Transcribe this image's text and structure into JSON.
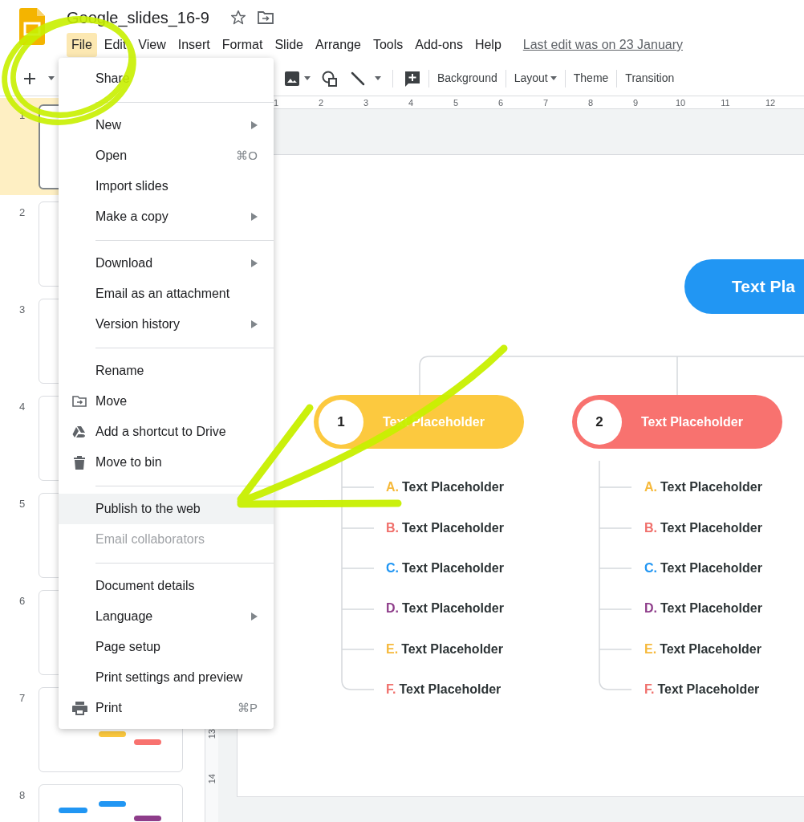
{
  "document": {
    "title": "Google_slides_16-9",
    "last_edit": "Last edit was on 23 January"
  },
  "menu_bar": [
    {
      "label": "File",
      "selected": true
    },
    {
      "label": "Edit",
      "selected": false
    },
    {
      "label": "View",
      "selected": false
    },
    {
      "label": "Insert",
      "selected": false
    },
    {
      "label": "Format",
      "selected": false
    },
    {
      "label": "Slide",
      "selected": false
    },
    {
      "label": "Arrange",
      "selected": false
    },
    {
      "label": "Tools",
      "selected": false
    },
    {
      "label": "Add-ons",
      "selected": false
    },
    {
      "label": "Help",
      "selected": false
    }
  ],
  "toolbar": {
    "buttons": [
      {
        "label": "Background",
        "kind": "text"
      },
      {
        "label": "Layout",
        "kind": "dropdown"
      },
      {
        "label": "Theme",
        "kind": "text"
      },
      {
        "label": "Transition",
        "kind": "text"
      }
    ]
  },
  "ruler": {
    "horizontal": [
      "1",
      "2",
      "3",
      "4",
      "5",
      "6",
      "7",
      "8",
      "9",
      "10",
      "11",
      "12"
    ],
    "vertical": [
      "13",
      "14"
    ]
  },
  "slides": [
    {
      "number": "1",
      "selected": true
    },
    {
      "number": "2",
      "selected": false
    },
    {
      "number": "3",
      "selected": false
    },
    {
      "number": "4",
      "selected": false
    },
    {
      "number": "5",
      "selected": false
    },
    {
      "number": "6",
      "selected": false
    },
    {
      "number": "7",
      "selected": false
    },
    {
      "number": "8",
      "selected": false
    }
  ],
  "file_menu": {
    "sections": [
      [
        {
          "label": "Share",
          "kind": "plain",
          "submenu": false,
          "highlighted": false,
          "disabled": false
        }
      ],
      [
        {
          "label": "New",
          "kind": "plain",
          "submenu": true,
          "highlighted": false,
          "disabled": false
        },
        {
          "label": "Open",
          "shortcut": "⌘O",
          "kind": "plain",
          "submenu": false,
          "highlighted": false,
          "disabled": false
        },
        {
          "label": "Import slides",
          "kind": "plain",
          "submenu": false,
          "highlighted": false,
          "disabled": false
        },
        {
          "label": "Make a copy",
          "kind": "plain",
          "submenu": true,
          "highlighted": false,
          "disabled": false
        }
      ],
      [
        {
          "label": "Download",
          "kind": "plain",
          "submenu": true,
          "highlighted": false,
          "disabled": false
        },
        {
          "label": "Email as an attachment",
          "kind": "plain",
          "submenu": false,
          "highlighted": false,
          "disabled": false
        },
        {
          "label": "Version history",
          "kind": "plain",
          "submenu": true,
          "highlighted": false,
          "disabled": false
        }
      ],
      [
        {
          "label": "Rename",
          "kind": "plain",
          "submenu": false,
          "highlighted": false,
          "disabled": false
        },
        {
          "label": "Move",
          "kind": "folder",
          "submenu": false,
          "highlighted": false,
          "disabled": false
        },
        {
          "label": "Add a shortcut to Drive",
          "kind": "drive",
          "submenu": false,
          "highlighted": false,
          "disabled": false
        },
        {
          "label": "Move to bin",
          "kind": "trash",
          "submenu": false,
          "highlighted": false,
          "disabled": false
        }
      ],
      [
        {
          "label": "Publish to the web",
          "kind": "plain",
          "submenu": false,
          "highlighted": true,
          "disabled": false
        },
        {
          "label": "Email collaborators",
          "kind": "plain",
          "submenu": false,
          "highlighted": false,
          "disabled": true
        }
      ],
      [
        {
          "label": "Document details",
          "kind": "plain",
          "submenu": false,
          "highlighted": false,
          "disabled": false
        },
        {
          "label": "Language",
          "kind": "plain",
          "submenu": true,
          "highlighted": false,
          "disabled": false
        },
        {
          "label": "Page setup",
          "kind": "plain",
          "submenu": false,
          "highlighted": false,
          "disabled": false
        },
        {
          "label": "Print settings and preview",
          "kind": "plain",
          "submenu": false,
          "highlighted": false,
          "disabled": false
        },
        {
          "label": "Print",
          "shortcut": "⌘P",
          "kind": "printer",
          "submenu": false,
          "highlighted": false,
          "disabled": false
        }
      ]
    ]
  },
  "slide": {
    "title": "Text Pla",
    "branches": [
      {
        "number": "1",
        "label": "Text Placeholder",
        "color": "#fcc93f",
        "items": [
          {
            "letter": "A.",
            "text": "Text Placeholder",
            "color": "#f6b93b"
          },
          {
            "letter": "B.",
            "text": "Text Placeholder",
            "color": "#f0706c"
          },
          {
            "letter": "C.",
            "text": "Text Placeholder",
            "color": "#2196f3"
          },
          {
            "letter": "D.",
            "text": "Text Placeholder",
            "color": "#8e3d8a"
          },
          {
            "letter": "E.",
            "text": "Text Placeholder",
            "color": "#f6b93b"
          },
          {
            "letter": "F.",
            "text": "Text Placeholder",
            "color": "#f0706c"
          }
        ]
      },
      {
        "number": "2",
        "label": "Text Placeholder",
        "color": "#f8726f",
        "items": [
          {
            "letter": "A.",
            "text": "Text Placeholder",
            "color": "#f6b93b"
          },
          {
            "letter": "B.",
            "text": "Text Placeholder",
            "color": "#f0706c"
          },
          {
            "letter": "C.",
            "text": "Text Placeholder",
            "color": "#2196f3"
          },
          {
            "letter": "D.",
            "text": "Text Placeholder",
            "color": "#8e3d8a"
          },
          {
            "letter": "E.",
            "text": "Text Placeholder",
            "color": "#f6b93b"
          },
          {
            "letter": "F.",
            "text": "Text Placeholder",
            "color": "#f0706c"
          }
        ]
      }
    ]
  }
}
